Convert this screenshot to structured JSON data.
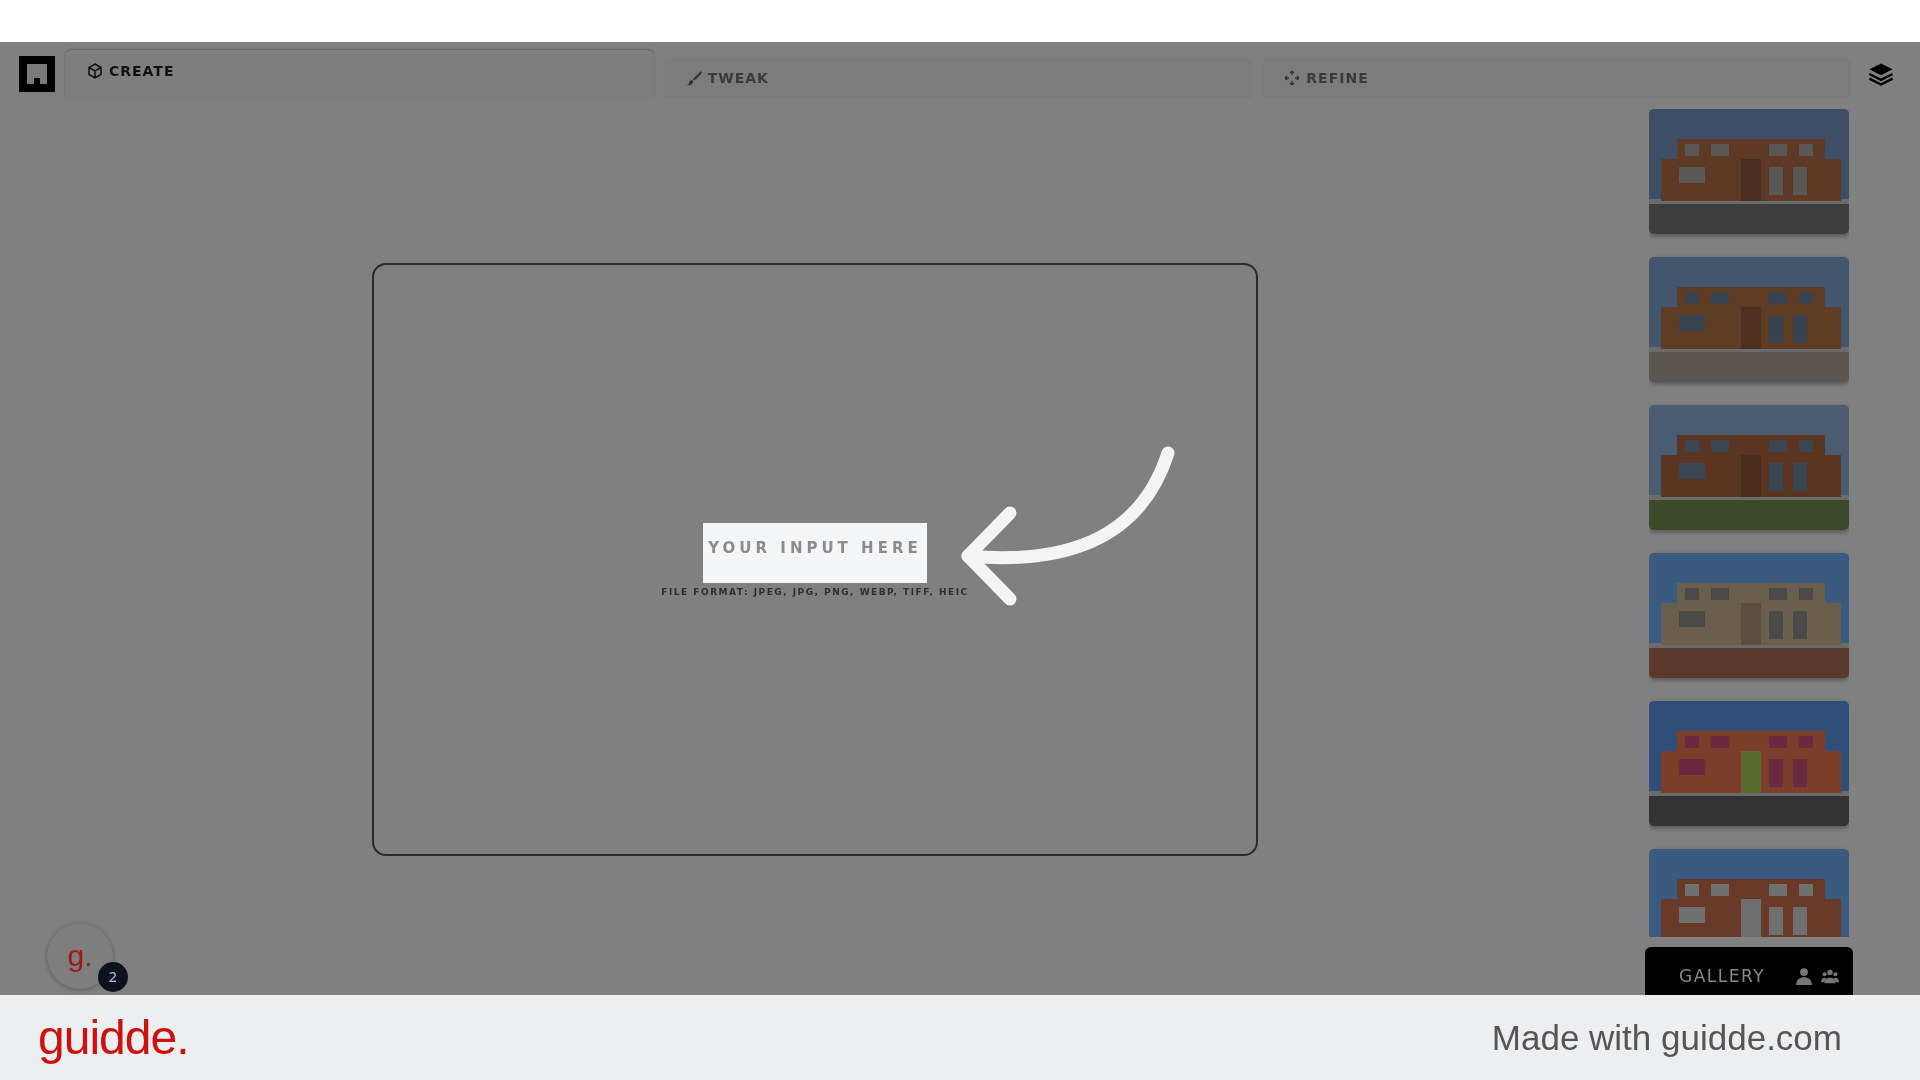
{
  "tabs": [
    {
      "label": "CREATE",
      "selected": true
    },
    {
      "label": "TWEAK",
      "selected": false
    },
    {
      "label": "REFINE",
      "selected": false
    }
  ],
  "upload": {
    "title": "YOUR INPUT HERE",
    "formats": "FILE FORMAT: JPEG, JPG, PNG, WEBP, TIFF, HEIC"
  },
  "gallery": {
    "label": "GALLERY"
  },
  "avatar": {
    "letter": "g.",
    "badge": "2"
  },
  "footer": {
    "logo": "guidde.",
    "credit": "Made with guidde.com"
  }
}
